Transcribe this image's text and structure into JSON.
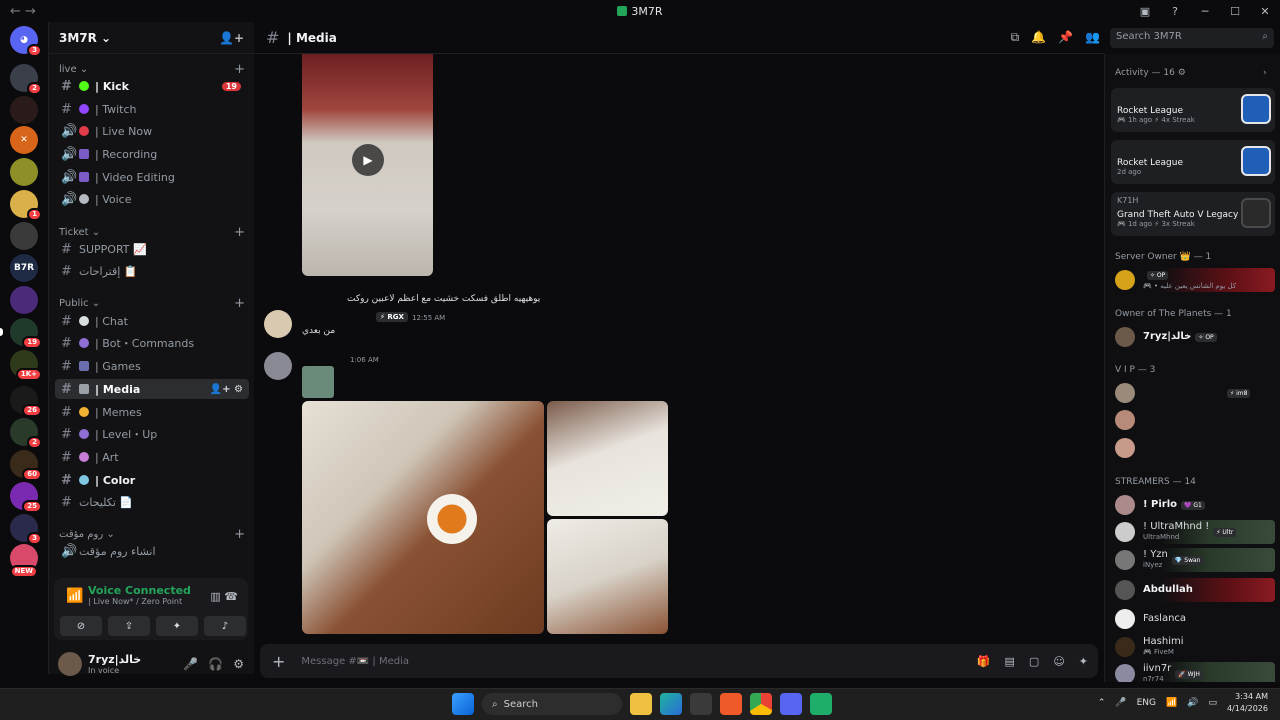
{
  "window": {
    "title": "3M7R",
    "back": "←",
    "forward": "→"
  },
  "server": {
    "name": "3M7R ⌄"
  },
  "categories": [
    {
      "name": "live ⌄"
    },
    {
      "name": "Ticket ⌄"
    },
    {
      "name": "Public ⌄"
    },
    {
      "name": "روم مؤقت ⌄"
    }
  ],
  "channels": [
    {
      "icon": "#",
      "label": "| Kick",
      "badge": "19"
    },
    {
      "icon": "#",
      "label": "| Twitch"
    },
    {
      "icon": "🔊",
      "label": "| Live Now"
    },
    {
      "icon": "🔊",
      "label": "| Recording"
    },
    {
      "icon": "🔊",
      "label": "| Video Editing"
    },
    {
      "icon": "🔊",
      "label": "| Voice"
    },
    {
      "icon": "#",
      "label": "SUPPORT 📈"
    },
    {
      "icon": "#",
      "label": "إقتراحات 📋"
    },
    {
      "icon": "#",
      "label": "| Chat"
    },
    {
      "icon": "#",
      "label": "| Bot・Commands"
    },
    {
      "icon": "#",
      "label": "| Games"
    },
    {
      "icon": "#",
      "label": "| Media"
    },
    {
      "icon": "#",
      "label": "| Memes"
    },
    {
      "icon": "#",
      "label": "| Level・Up"
    },
    {
      "icon": "#",
      "label": "| Art"
    },
    {
      "icon": "#",
      "label": "| Color"
    },
    {
      "icon": "#",
      "label": "تكليحات 📄"
    },
    {
      "icon": "🔊",
      "label": "انشاء روم مؤقت"
    }
  ],
  "voice": {
    "status": "Voice Connected",
    "location": "| Live Now* / Zero Point"
  },
  "user": {
    "name": "7ryz|خالد",
    "status": "In voice"
  },
  "channel_header": {
    "name": "| Media"
  },
  "search": {
    "placeholder": "Search 3M7R"
  },
  "messages": {
    "reply_text": "يوهيهيه اطلق فسكت خشيت مع اعظم لاعبين روكت",
    "tag1": "⚡ RGX",
    "time1": "12:55 AM",
    "text1": "من بعدي",
    "time2": "1:06 AM"
  },
  "composer": {
    "placeholder": "Message #📼 | Media"
  },
  "activity": {
    "header": "Activity — 16 ⚙",
    "cards": [
      {
        "user": "",
        "game": "Rocket League",
        "meta": "🎮 1h ago  ⚡ 4x Streak"
      },
      {
        "user": "",
        "game": "Rocket League",
        "meta": "2d ago"
      },
      {
        "user": "K71H",
        "game": "Grand Theft Auto V Legacy",
        "meta": "🎮 1d ago  ⚡ 3x Streak"
      }
    ]
  },
  "groups": {
    "owner": "Server Owner 👑 — 1",
    "planets": "Owner of The Planets — 1",
    "vip": "V I P — 3",
    "streamers": "STREAMERS — 14"
  },
  "members": {
    "owner_tag": "✧ OP",
    "owner_sub": "🎮 • كل يوم الشانس يعين عليه",
    "planet_name": "7ryz|خالد",
    "planet_tag": "✧ OP",
    "vip_tag": "⚡ im8",
    "s1": "! Pirlo",
    "s1_tag": "💜 G1",
    "s2": "! UltraMhnd !",
    "s2_tag": "⚡ Ultr",
    "s2_sub": "UltraMhnd",
    "s3": "! Yzn",
    "s3_tag": "💎 Swan",
    "s3_sub": "iNyez",
    "s4": "Abdullah",
    "s5": "Faslanca",
    "s6": "Hashimi",
    "s6_sub": "🎮 FiveM",
    "s7": "iivn7r",
    "s7_tag": "🚀 WJH",
    "s7_sub": "n7r74"
  },
  "server_badges": [
    "3",
    "2",
    "1",
    "19",
    "1K+",
    "26",
    "2",
    "60",
    "25",
    "3",
    "NEW"
  ],
  "taskbar": {
    "search": "Search",
    "lang": "ENG",
    "time": "3:34 AM",
    "date": "4/14/2026"
  },
  "colors": {
    "accent": "#5865f2",
    "online": "#23a559",
    "badge": "#f23f43"
  }
}
